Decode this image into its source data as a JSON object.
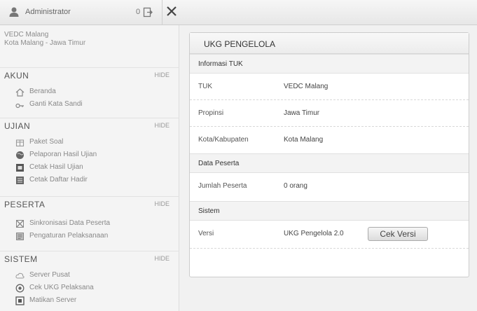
{
  "topbar": {
    "user": "Administrator",
    "badge": "0"
  },
  "sidebar": {
    "site_name": "VEDC Malang",
    "site_location": "Kota Malang - Jawa Timur",
    "sections": [
      {
        "title": "AKUN",
        "hide": "HIDE",
        "items": [
          {
            "label": "Beranda",
            "icon": "home-icon"
          },
          {
            "label": "Ganti Kata Sandi",
            "icon": "key-icon"
          }
        ]
      },
      {
        "title": "UJIAN",
        "hide": "HIDE",
        "items": [
          {
            "label": "Paket Soal",
            "icon": "package-icon"
          },
          {
            "label": "Pelaporan Hasil Ujian",
            "icon": "globe-icon"
          },
          {
            "label": "Cetak Hasil Ujian",
            "icon": "print-icon"
          },
          {
            "label": "Cetak Daftar Hadir",
            "icon": "list-icon"
          }
        ]
      },
      {
        "title": "PESERTA",
        "hide": "HIDE",
        "items": [
          {
            "label": "Sinkronisasi Data Peserta",
            "icon": "sync-icon"
          },
          {
            "label": "Pengaturan Pelaksanaan",
            "icon": "settings-icon"
          }
        ]
      },
      {
        "title": "SISTEM",
        "hide": "HIDE",
        "items": [
          {
            "label": "Server Pusat",
            "icon": "cloud-icon"
          },
          {
            "label": "Cek UKG Pelaksana",
            "icon": "check-icon"
          },
          {
            "label": "Matikan Server",
            "icon": "power-icon"
          }
        ]
      }
    ]
  },
  "main": {
    "title": "UKG PENGELOLA",
    "info_header": "Informasi TUK",
    "rows": [
      {
        "label": "TUK",
        "value": "VEDC Malang"
      },
      {
        "label": "Propinsi",
        "value": "Jawa Timur"
      },
      {
        "label": "Kota/Kabupaten",
        "value": "Kota Malang"
      }
    ],
    "peserta_header": "Data Peserta",
    "peserta_row": {
      "label": "Jumlah Peserta",
      "value": "0 orang"
    },
    "sistem_header": "Sistem",
    "versi_row": {
      "label": "Versi",
      "value": "UKG Pengelola 2.0",
      "button": "Cek Versi"
    }
  }
}
